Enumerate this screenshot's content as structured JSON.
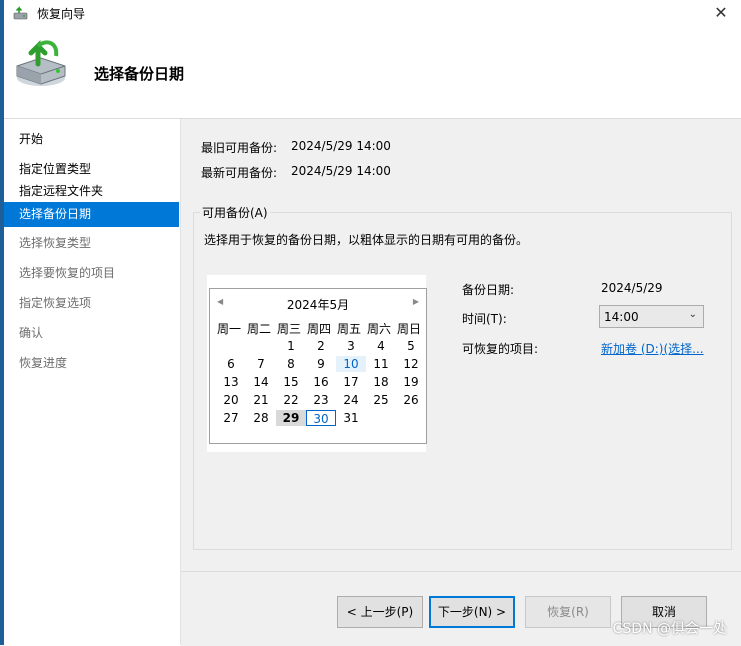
{
  "window": {
    "title": "恢复向导",
    "close_icon": "close-icon"
  },
  "header": {
    "title": "选择备份日期",
    "icon": "backup-restore-icon"
  },
  "sidebar": {
    "items": [
      {
        "label": "开始",
        "state": "normal"
      },
      {
        "label": "指定位置类型",
        "state": "normal"
      },
      {
        "label": "指定远程文件夹",
        "state": "normal"
      },
      {
        "label": "选择备份日期",
        "state": "selected"
      },
      {
        "label": "选择恢复类型",
        "state": "disabled"
      },
      {
        "label": "选择要恢复的项目",
        "state": "disabled"
      },
      {
        "label": "指定恢复选项",
        "state": "disabled"
      },
      {
        "label": "确认",
        "state": "disabled"
      },
      {
        "label": "恢复进度",
        "state": "disabled"
      }
    ]
  },
  "info": {
    "oldest_label": "最旧可用备份:",
    "oldest_value": "2024/5/29 14:00",
    "newest_label": "最新可用备份:",
    "newest_value": "2024/5/29 14:00"
  },
  "group": {
    "label": "可用备份(A)",
    "description": "选择用于恢复的备份日期，以粗体显示的日期有可用的备份。"
  },
  "calendar": {
    "month_label": "2024年5月",
    "weekdays": [
      "周一",
      "周二",
      "周三",
      "周四",
      "周五",
      "周六",
      "周日"
    ],
    "weeks": [
      [
        "",
        "",
        "1",
        "2",
        "3",
        "4",
        "5"
      ],
      [
        "6",
        "7",
        "8",
        "9",
        "10",
        "11",
        "12"
      ],
      [
        "13",
        "14",
        "15",
        "16",
        "17",
        "18",
        "19"
      ],
      [
        "20",
        "21",
        "22",
        "23",
        "24",
        "25",
        "26"
      ],
      [
        "27",
        "28",
        "29",
        "30",
        "31",
        "",
        ""
      ]
    ],
    "available_date": "29",
    "today_date": "30",
    "hover_date": "10"
  },
  "details": {
    "backup_date_label": "备份日期:",
    "backup_date_value": "2024/5/29",
    "time_label": "时间(T):",
    "time_value": "14:00",
    "items_label": "可恢复的项目:",
    "items_link": "新加卷 (D:)(选择..."
  },
  "buttons": {
    "back": "< 上一步(P)",
    "next": "下一步(N) >",
    "recover": "恢复(R)",
    "cancel": "取消"
  },
  "watermark": "CSDN @俱会一处",
  "colors": {
    "accent": "#0078d7",
    "link": "#0066cc"
  }
}
